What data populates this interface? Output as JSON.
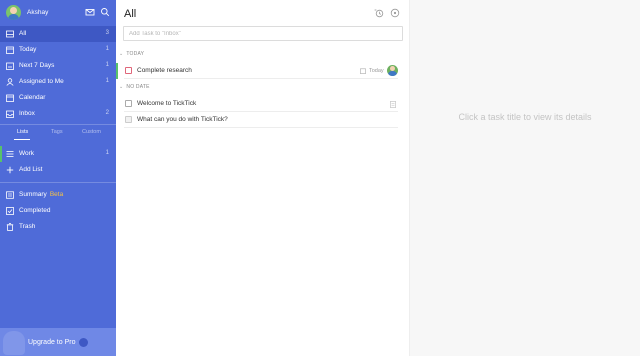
{
  "sidebar": {
    "user": {
      "name": "Akshay"
    },
    "nav": [
      {
        "key": "all",
        "label": "All",
        "count": "3",
        "icon": "inbox-tray-icon",
        "active": true
      },
      {
        "key": "today",
        "label": "Today",
        "count": "1",
        "icon": "calendar-today-icon"
      },
      {
        "key": "next7",
        "label": "Next 7 Days",
        "count": "1",
        "icon": "calendar-week-icon"
      },
      {
        "key": "assigned",
        "label": "Assigned to Me",
        "count": "1",
        "icon": "person-icon"
      },
      {
        "key": "calendar",
        "label": "Calendar",
        "count": "",
        "icon": "calendar-icon"
      },
      {
        "key": "inbox",
        "label": "Inbox",
        "count": "2",
        "icon": "inbox-icon"
      }
    ],
    "tabs": [
      {
        "label": "Lists",
        "active": true
      },
      {
        "label": "Tags"
      },
      {
        "label": "Custom"
      }
    ],
    "lists": [
      {
        "label": "Work",
        "count": "1",
        "icon": "list-icon"
      },
      {
        "label": "Add List",
        "icon": "plus-icon"
      }
    ],
    "bottom": [
      {
        "label": "Summary",
        "badge": "Beta",
        "icon": "summary-icon"
      },
      {
        "label": "Completed",
        "icon": "check-square-icon"
      },
      {
        "label": "Trash",
        "icon": "trash-icon"
      }
    ],
    "upgrade_label": "Upgrade to Pro"
  },
  "main": {
    "title": "All",
    "add_placeholder": "Add Task to \"Inbox\"",
    "sections": [
      {
        "label": "TODAY",
        "tasks": [
          {
            "title": "Complete research",
            "date": "Today",
            "priority": true
          }
        ]
      },
      {
        "label": "NO DATE",
        "tasks": [
          {
            "title": "Welcome to TickTick"
          },
          {
            "title": "What can you do with TickTick?"
          }
        ]
      }
    ]
  },
  "detail": {
    "hint": "Click a task title to view its details"
  },
  "colors": {
    "sidebar_bg": "#4f6bd8",
    "sidebar_active": "#3e58c4",
    "accent_green": "#58c26a",
    "beta_yellow": "#f6c344",
    "priority_red": "#e0667a"
  }
}
